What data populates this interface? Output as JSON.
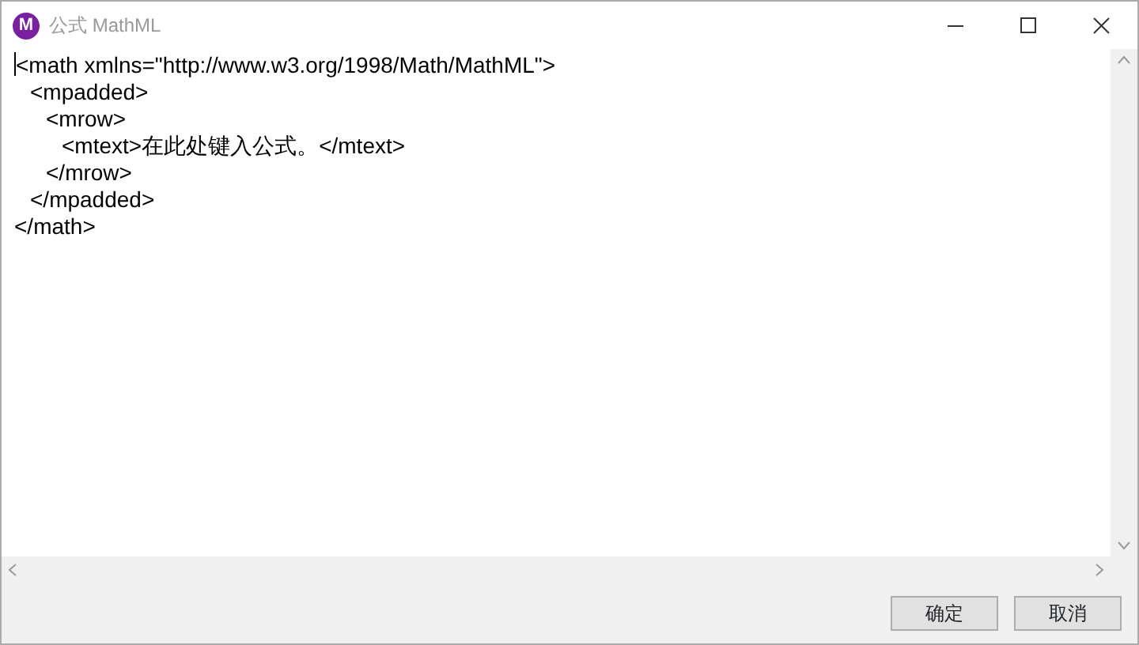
{
  "window": {
    "title": "公式 MathML",
    "app_icon_letter": "M"
  },
  "editor": {
    "lines": [
      {
        "text": "<math xmlns=\"http://www.w3.org/1998/Math/MathML\">",
        "children": [
          {
            "text": "<mpadded>",
            "children": [
              {
                "text": "<mrow>",
                "children": [
                  {
                    "text": "<mtext>在此处键入公式。</mtext>"
                  }
                ]
              },
              {
                "text": "</mrow>"
              }
            ]
          },
          {
            "text": "</mpadded>"
          }
        ]
      },
      {
        "text": "</math>"
      }
    ]
  },
  "buttons": [
    {
      "label": "确定"
    },
    {
      "label": "取消"
    }
  ]
}
